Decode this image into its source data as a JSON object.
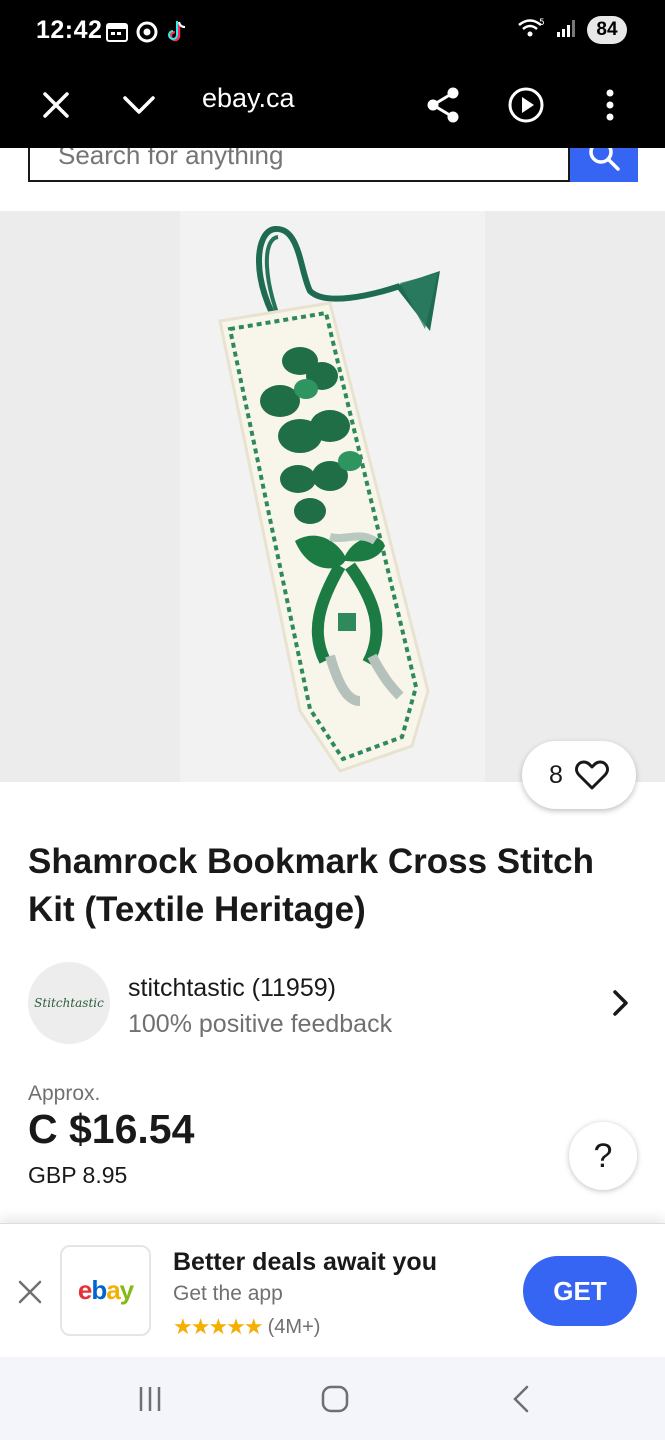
{
  "status_bar": {
    "time": "12:42",
    "battery": "84",
    "network": "5"
  },
  "browser": {
    "url": "ebay.ca"
  },
  "search": {
    "placeholder": "Search for anything"
  },
  "product": {
    "watch_count": "8",
    "title": "Shamrock Bookmark Cross Stitch Kit (Textile Heritage)"
  },
  "seller": {
    "avatar_text": "Stitchtastic",
    "name": "stitchtastic (11959)",
    "feedback": "100% positive feedback"
  },
  "price": {
    "approx_label": "Approx.",
    "converted": "C $16.54",
    "original": "GBP 8.95"
  },
  "help": {
    "label": "?"
  },
  "app_banner": {
    "logo_letters": [
      "e",
      "b",
      "a",
      "y"
    ],
    "logo_colors": [
      "#e53238",
      "#0064d2",
      "#f5af02",
      "#86b817"
    ],
    "title": "Better deals await you",
    "subtitle": "Get the app",
    "stars": "★★★★★",
    "rating_count": "(4M+)",
    "button_label": "GET"
  },
  "colors": {
    "accent": "#3665f3",
    "text": "#191919",
    "muted": "#707070",
    "image_bg": "#ececec"
  }
}
